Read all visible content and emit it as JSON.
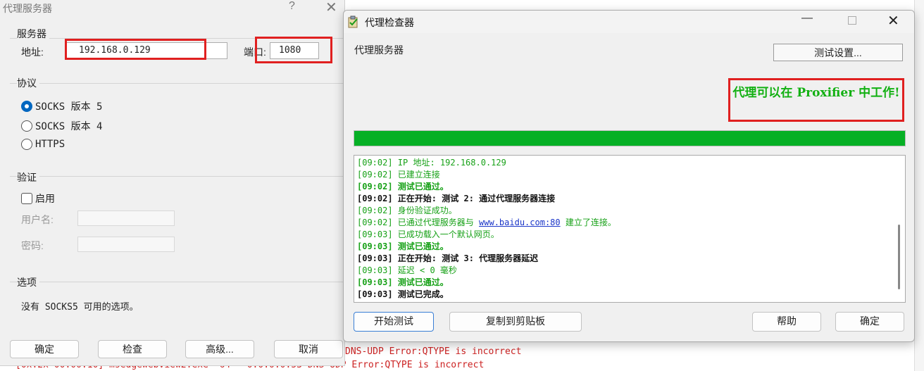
{
  "background_log": {
    "lines": [
      "DNS-UDP Error:QTYPE is incorrect",
      "[0x.2x 00:00:10] msedgewebview2.exe *64 - 0.0.0.0:53 DNS-UDP Error:QTYPE is incorrect"
    ]
  },
  "left_dialog": {
    "title": "代理服务器",
    "help": "?",
    "close": "✕",
    "server": {
      "group_label": "服务器",
      "address_label": "地址:",
      "address_value": "192.168.0.129",
      "port_label": "端口:",
      "port_value": "1080"
    },
    "protocol": {
      "group_label": "协议",
      "options": [
        "SOCKS 版本 5",
        "SOCKS 版本 4",
        "HTTPS"
      ],
      "selected": "SOCKS 版本 5"
    },
    "auth": {
      "group_label": "验证",
      "enable_label": "启用",
      "username_label": "用户名:",
      "password_label": "密码:"
    },
    "options": {
      "group_label": "选项",
      "text": "没有 SOCKS5 可用的选项。"
    },
    "buttons": {
      "ok": "确定",
      "check": "检查",
      "advanced": "高级...",
      "cancel": "取消"
    }
  },
  "checker": {
    "title": "代理检查器",
    "server_label": "代理服务器",
    "test_settings": "测试设置...",
    "status": "代理可以在 Proxifier 中工作!",
    "progress": 1.0,
    "progress_color": "#06b025",
    "log": [
      {
        "style": "ok",
        "text": "[09:02] IP 地址: 192.168.0.129"
      },
      {
        "style": "ok",
        "text": "[09:02] 已建立连接"
      },
      {
        "style": "boldgreen",
        "text": "[09:02] 测试已通过。"
      },
      {
        "style": "bold",
        "text": "[09:02] 正在开始: 测试 2: 通过代理服务器连接"
      },
      {
        "style": "ok",
        "text": "[09:02] 身份验证成功。"
      },
      {
        "style": "ok",
        "text_before": "[09:02] 已通过代理服务器与 ",
        "link": "www.baidu.com:80",
        "text_after": " 建立了连接。"
      },
      {
        "style": "ok",
        "text": "[09:03] 已成功载入一个默认网页。"
      },
      {
        "style": "boldgreen",
        "text": "[09:03] 测试已通过。"
      },
      {
        "style": "bold",
        "text": "[09:03] 正在开始: 测试 3: 代理服务器延迟"
      },
      {
        "style": "ok",
        "text": "[09:03] 延迟 < 0 毫秒"
      },
      {
        "style": "boldgreen",
        "text": "[09:03] 测试已通过。"
      },
      {
        "style": "bold",
        "text": "[09:03] 测试已完成。"
      }
    ],
    "buttons": {
      "start": "开始测试",
      "copy": "复制到剪贴板",
      "help": "帮助",
      "ok": "确定"
    },
    "window_controls": {
      "minimize": "—",
      "close": "✕"
    }
  },
  "colors": {
    "highlight_red": "#e02020",
    "success_green": "#12b012",
    "log_green": "#17a117",
    "link_blue": "#1a35c8"
  }
}
